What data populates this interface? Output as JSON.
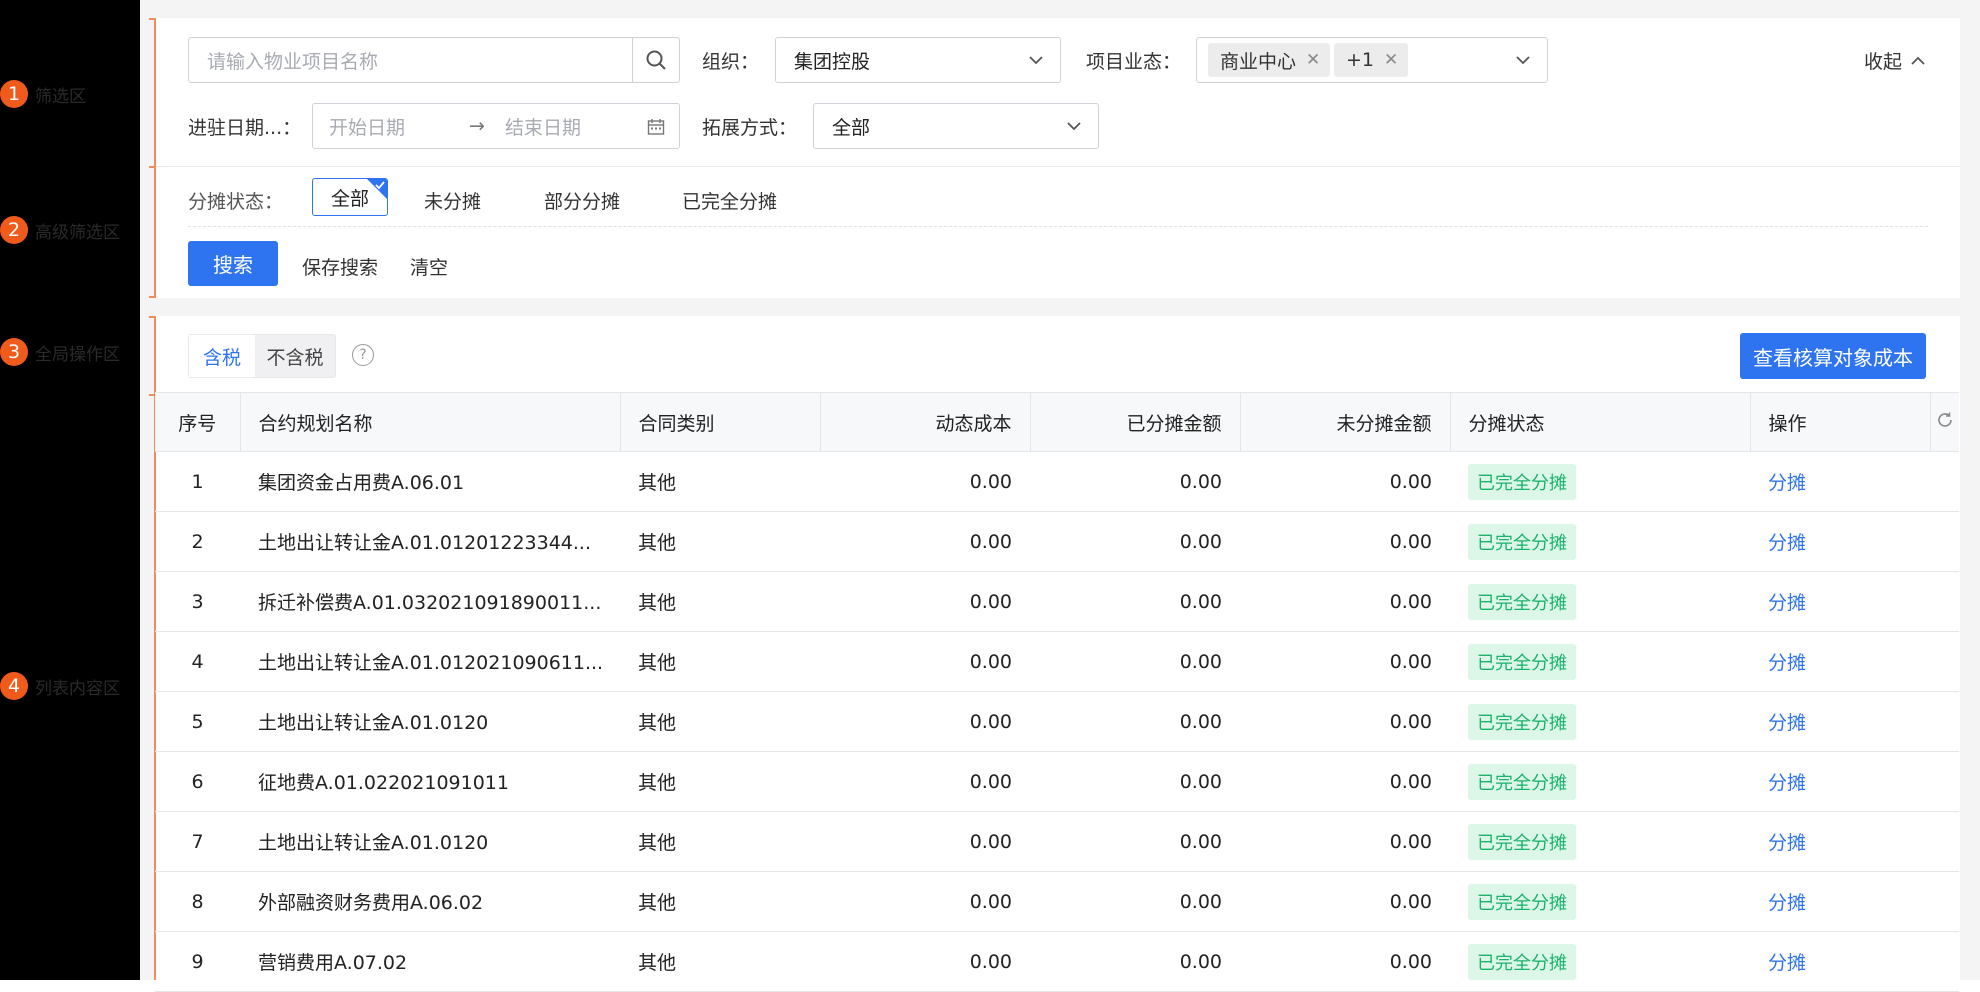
{
  "annotations": [
    {
      "num": "1",
      "label": "筛选区"
    },
    {
      "num": "2",
      "label": "高级筛选区"
    },
    {
      "num": "3",
      "label": "全局操作区"
    },
    {
      "num": "4",
      "label": "列表内容区"
    }
  ],
  "filter": {
    "search_placeholder": "请输入物业项目名称",
    "org_label": "组织：",
    "org_value": "集团控股",
    "business_label": "项目业态：",
    "business_tags": [
      "商业中心",
      "+1"
    ],
    "collapse_label": "收起",
    "date_label": "进驻日期...：",
    "date_start_placeholder": "开始日期",
    "date_arrow": "→",
    "date_end_placeholder": "结束日期",
    "expand_label": "拓展方式：",
    "expand_value": "全部"
  },
  "advanced": {
    "status_label": "分摊状态：",
    "status_options": [
      "全部",
      "未分摊",
      "部分分摊",
      "已完全分摊"
    ],
    "selected_status": "全部",
    "search_button": "搜索",
    "save_search": "保存搜索",
    "clear": "清空"
  },
  "global": {
    "tax_tabs": [
      "含税",
      "不含税"
    ],
    "selected_tax": "含税",
    "help_icon": "?",
    "view_cost_button": "查看核算对象成本"
  },
  "table": {
    "columns": [
      "序号",
      "合约规划名称",
      "合同类别",
      "动态成本",
      "已分摊金额",
      "未分摊金额",
      "分摊状态",
      "操作"
    ],
    "rows": [
      {
        "no": "1",
        "name": "集团资金占用费A.06.01",
        "type": "其他",
        "dynamic": "0.00",
        "allocated": "0.00",
        "unallocated": "0.00",
        "status": "已完全分摊",
        "op": "分摊"
      },
      {
        "no": "2",
        "name": "土地出让转让金A.01.01201223344...",
        "type": "其他",
        "dynamic": "0.00",
        "allocated": "0.00",
        "unallocated": "0.00",
        "status": "已完全分摊",
        "op": "分摊"
      },
      {
        "no": "3",
        "name": "拆迁补偿费A.01.032021091890011...",
        "type": "其他",
        "dynamic": "0.00",
        "allocated": "0.00",
        "unallocated": "0.00",
        "status": "已完全分摊",
        "op": "分摊"
      },
      {
        "no": "4",
        "name": "土地出让转让金A.01.012021090611...",
        "type": "其他",
        "dynamic": "0.00",
        "allocated": "0.00",
        "unallocated": "0.00",
        "status": "已完全分摊",
        "op": "分摊"
      },
      {
        "no": "5",
        "name": "土地出让转让金A.01.0120",
        "type": "其他",
        "dynamic": "0.00",
        "allocated": "0.00",
        "unallocated": "0.00",
        "status": "已完全分摊",
        "op": "分摊"
      },
      {
        "no": "6",
        "name": "征地费A.01.022021091011",
        "type": "其他",
        "dynamic": "0.00",
        "allocated": "0.00",
        "unallocated": "0.00",
        "status": "已完全分摊",
        "op": "分摊"
      },
      {
        "no": "7",
        "name": "土地出让转让金A.01.0120",
        "type": "其他",
        "dynamic": "0.00",
        "allocated": "0.00",
        "unallocated": "0.00",
        "status": "已完全分摊",
        "op": "分摊"
      },
      {
        "no": "8",
        "name": "外部融资财务费用A.06.02",
        "type": "其他",
        "dynamic": "0.00",
        "allocated": "0.00",
        "unallocated": "0.00",
        "status": "已完全分摊",
        "op": "分摊"
      },
      {
        "no": "9",
        "name": "营销费用A.07.02",
        "type": "其他",
        "dynamic": "0.00",
        "allocated": "0.00",
        "unallocated": "0.00",
        "status": "已完全分摊",
        "op": "分摊"
      }
    ]
  },
  "colors": {
    "primary": "#2e74f0",
    "annotation": "#f05a1b",
    "status_green": "#19b36b",
    "status_green_bg": "#dcf6e8"
  }
}
